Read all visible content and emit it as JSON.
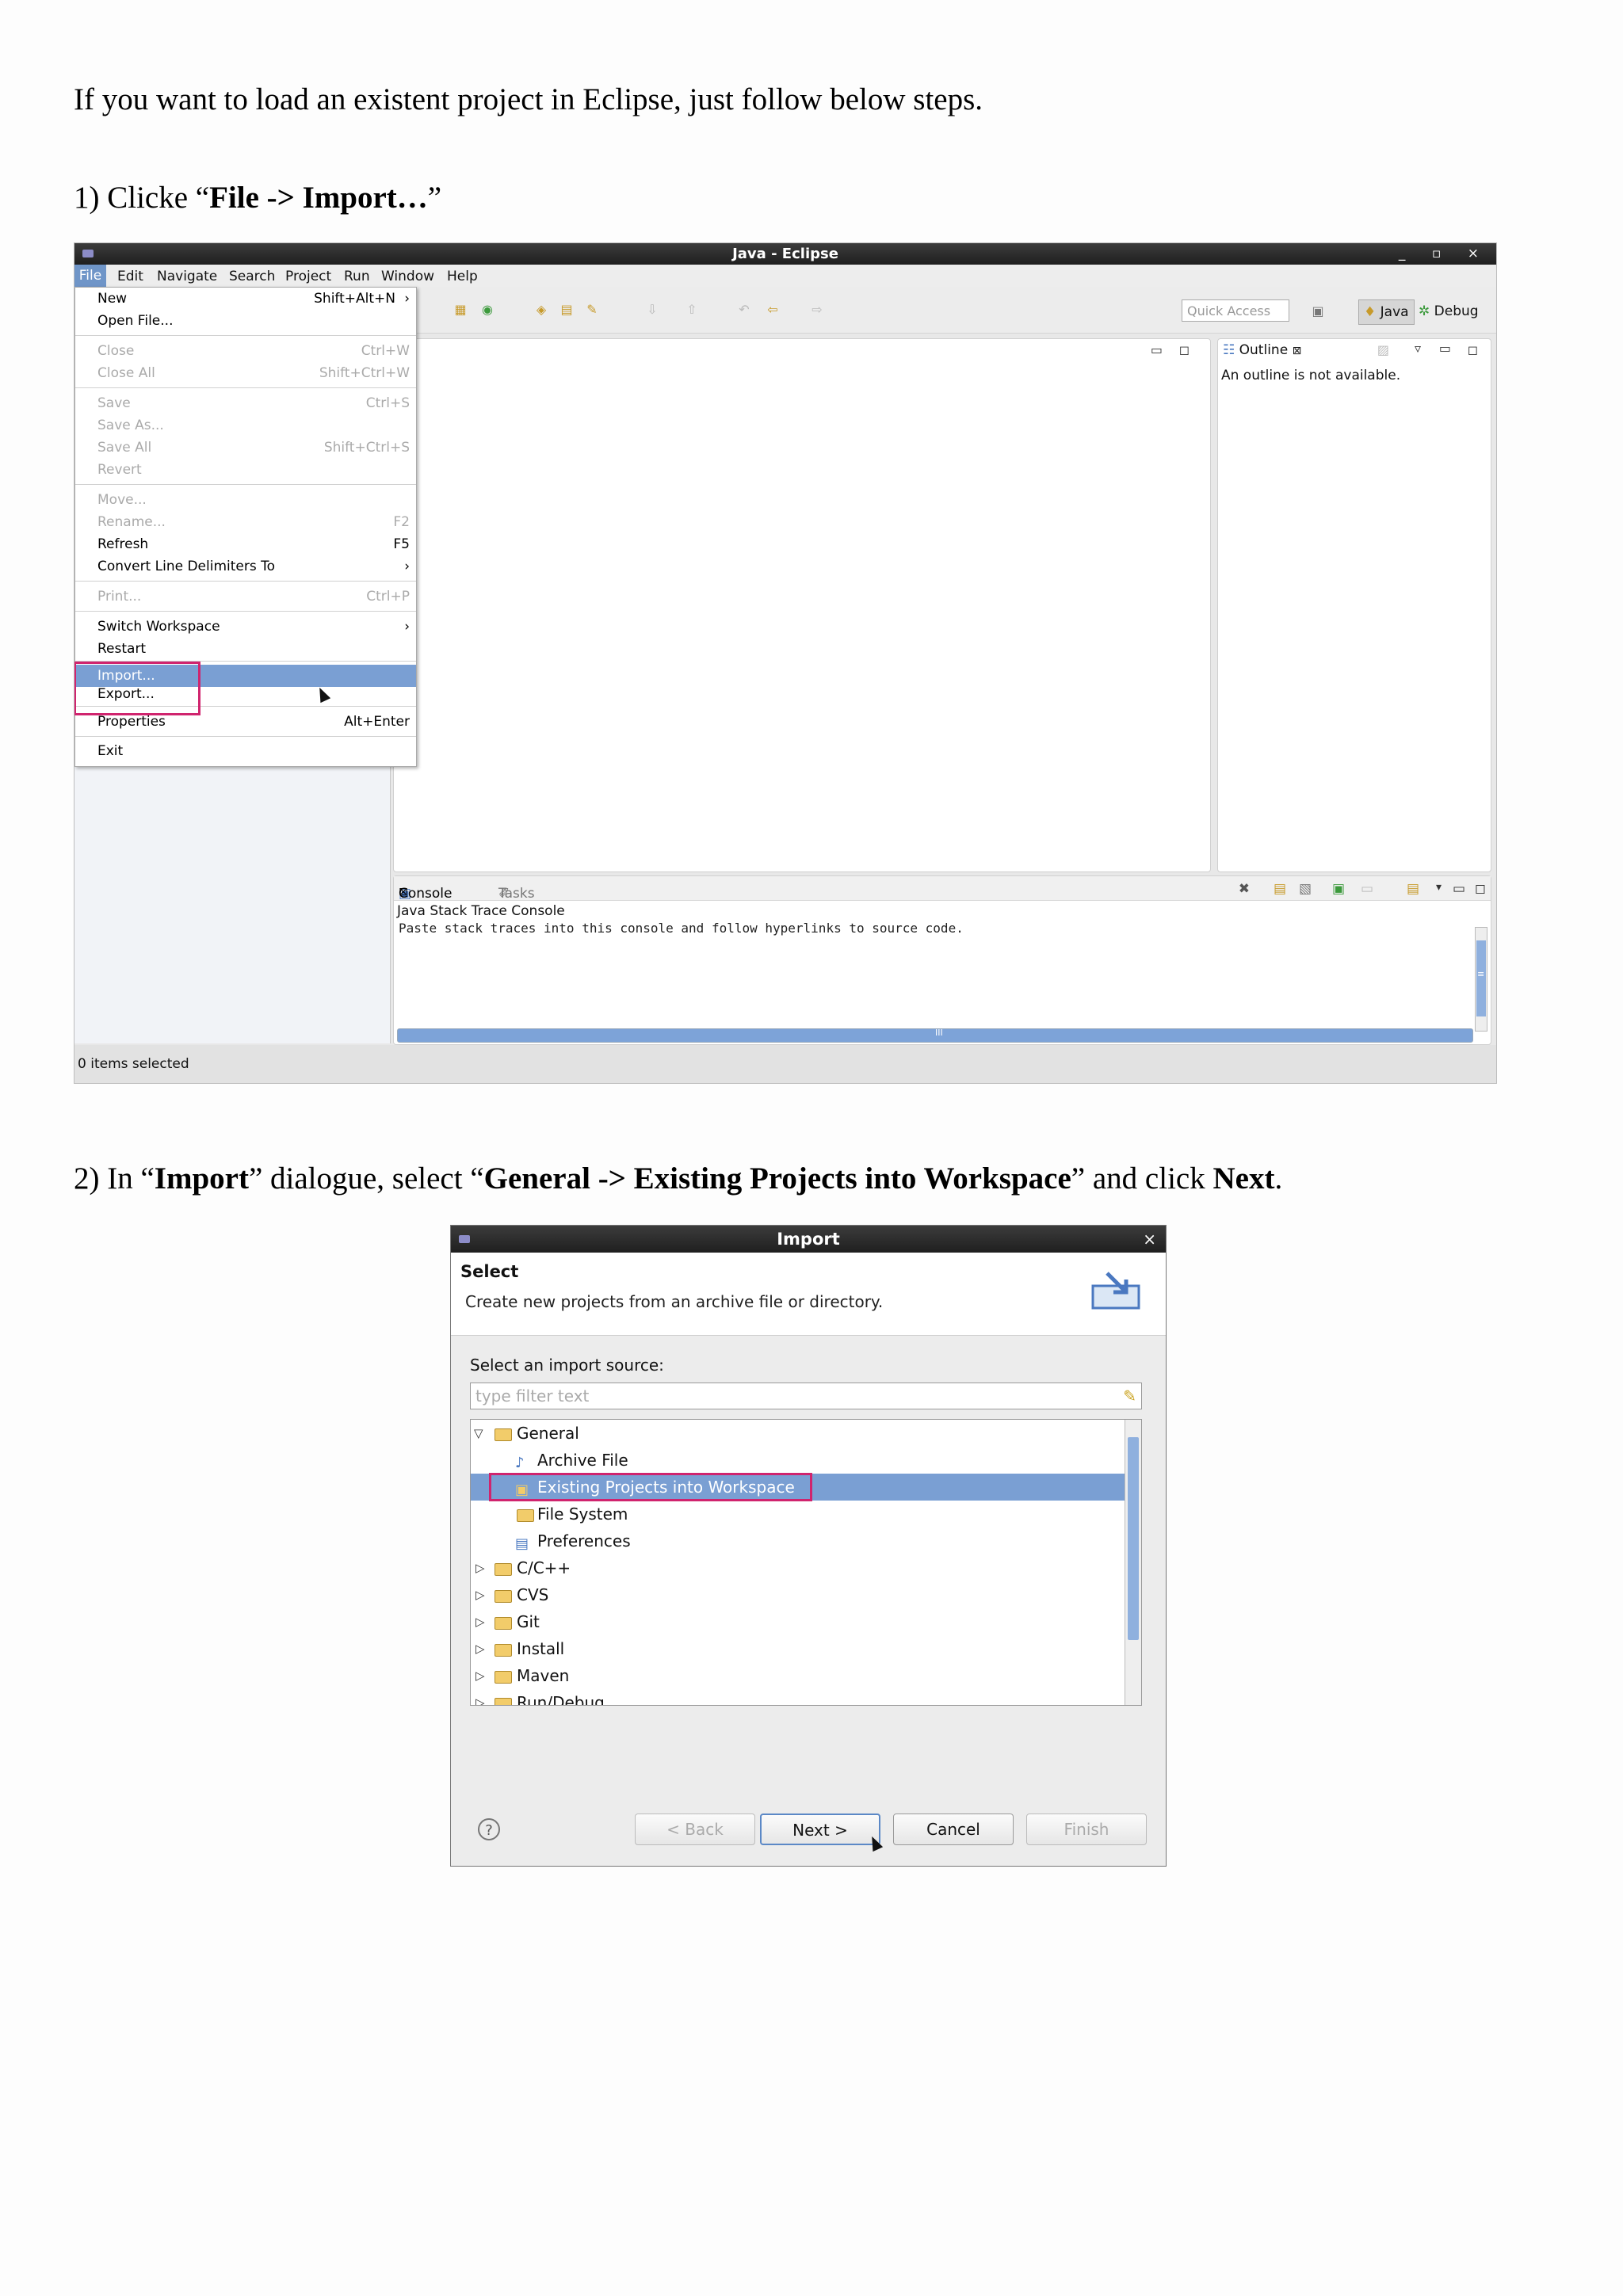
{
  "intro": "If you want to load an existent project in Eclipse, just follow below steps.",
  "step1": {
    "prefix": "1) Clicke “",
    "bold": "File -> Import…",
    "suffix": "”"
  },
  "step2": {
    "p1": "2) In “",
    "b1": "Import",
    "p2": "” dialogue, select “",
    "b2": "General -> Existing Projects into Workspace",
    "p3": "” and click ",
    "b3": "Next",
    "p4": "."
  },
  "eclipse": {
    "title": "Java - Eclipse",
    "window_controls": "_ ▫ ×",
    "menubar": [
      "File",
      "Edit",
      "Navigate",
      "Search",
      "Project",
      "Run",
      "Window",
      "Help"
    ],
    "file_menu": [
      {
        "label": "New",
        "accel": "Shift+Alt+N",
        "arrow": true,
        "enabled": true
      },
      {
        "label": "Open File...",
        "accel": "",
        "enabled": true
      },
      {
        "label": "Close",
        "accel": "Ctrl+W",
        "enabled": false
      },
      {
        "label": "Close All",
        "accel": "Shift+Ctrl+W",
        "enabled": false
      },
      {
        "label": "Save",
        "accel": "Ctrl+S",
        "enabled": false
      },
      {
        "label": "Save As...",
        "accel": "",
        "enabled": false
      },
      {
        "label": "Save All",
        "accel": "Shift+Ctrl+S",
        "enabled": false
      },
      {
        "label": "Revert",
        "accel": "",
        "enabled": false
      },
      {
        "label": "Move...",
        "accel": "",
        "enabled": false
      },
      {
        "label": "Rename...",
        "accel": "F2",
        "enabled": false
      },
      {
        "label": "Refresh",
        "accel": "F5",
        "enabled": true
      },
      {
        "label": "Convert Line Delimiters To",
        "accel": "",
        "arrow": true,
        "enabled": true
      },
      {
        "label": "Print...",
        "accel": "Ctrl+P",
        "enabled": false
      },
      {
        "label": "Switch Workspace",
        "accel": "",
        "arrow": true,
        "enabled": true
      },
      {
        "label": "Restart",
        "accel": "",
        "enabled": true
      },
      {
        "label": "Import...",
        "accel": "",
        "enabled": true,
        "highlighted": true
      },
      {
        "label": "Export...",
        "accel": "",
        "enabled": true
      },
      {
        "label": "Properties",
        "accel": "Alt+Enter",
        "enabled": true
      },
      {
        "label": "Exit",
        "accel": "",
        "enabled": true
      }
    ],
    "quick_access_placeholder": "Quick Access",
    "perspective_java": "Java",
    "perspective_debug": "Debug",
    "outline_tab": "Outline",
    "outline_message": "An outline is not available.",
    "console_tab": "Console",
    "tasks_tab": "Tasks",
    "console_header": "Java Stack Trace Console",
    "console_message": "Paste stack traces into this console and follow hyperlinks to source code.",
    "status": "0 items selected",
    "hscroll_grip": "III",
    "vscroll_grip": "≡"
  },
  "import_dialog": {
    "title": "Import",
    "heading": "Select",
    "description": "Create new projects from an archive file or directory.",
    "source_label": "Select an import source:",
    "filter_placeholder": "type filter text",
    "tree": [
      {
        "label": "General",
        "level": 0,
        "expanded": true,
        "icon": "folder-icon"
      },
      {
        "label": "Archive File",
        "level": 1,
        "icon": "archive-icon"
      },
      {
        "label": "Existing Projects into Workspace",
        "level": 1,
        "icon": "project-icon",
        "selected": true
      },
      {
        "label": "File System",
        "level": 1,
        "icon": "folder-icon"
      },
      {
        "label": "Preferences",
        "level": 1,
        "icon": "preferences-icon"
      },
      {
        "label": "C/C++",
        "level": 0,
        "expanded": false,
        "icon": "folder-icon"
      },
      {
        "label": "CVS",
        "level": 0,
        "expanded": false,
        "icon": "folder-icon"
      },
      {
        "label": "Git",
        "level": 0,
        "expanded": false,
        "icon": "folder-icon"
      },
      {
        "label": "Install",
        "level": 0,
        "expanded": false,
        "icon": "folder-icon"
      },
      {
        "label": "Maven",
        "level": 0,
        "expanded": false,
        "icon": "folder-icon"
      },
      {
        "label": "Run/Debug",
        "level": 0,
        "expanded": false,
        "icon": "folder-icon"
      }
    ],
    "buttons": {
      "back": "< Back",
      "next": "Next >",
      "cancel": "Cancel",
      "finish": "Finish"
    },
    "help": "?"
  },
  "colors": {
    "highlight": "#d0246e",
    "selection": "#7a9fd3"
  }
}
